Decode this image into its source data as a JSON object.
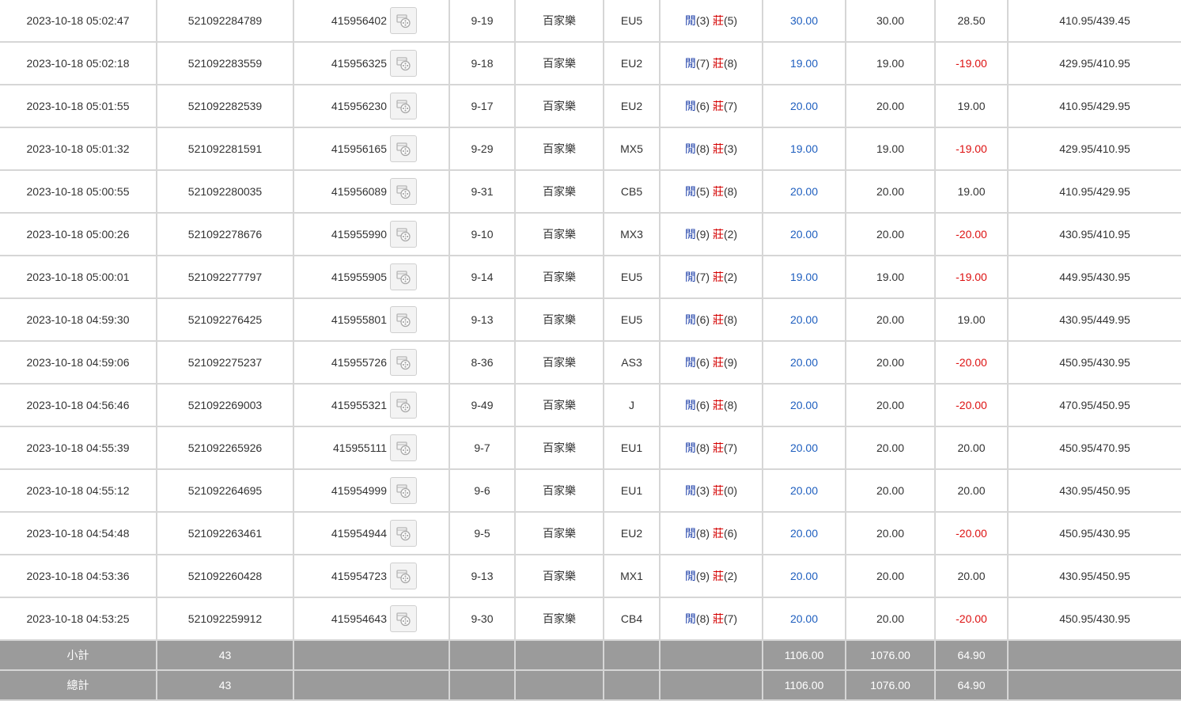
{
  "rows": [
    {
      "time": "2023-10-18 05:02:47",
      "bet_id": "521092284789",
      "round_id": "415956402",
      "shoe": "9-19",
      "game": "百家樂",
      "table": "EU5",
      "player_label": "閒",
      "player_score": "(3)",
      "banker_label": "莊",
      "banker_score": "(5)",
      "bet": "30.00",
      "valid": "30.00",
      "winloss": "28.50",
      "winloss_negative": false,
      "balance": "410.95/439.45"
    },
    {
      "time": "2023-10-18 05:02:18",
      "bet_id": "521092283559",
      "round_id": "415956325",
      "shoe": "9-18",
      "game": "百家樂",
      "table": "EU2",
      "player_label": "閒",
      "player_score": "(7)",
      "banker_label": "莊",
      "banker_score": "(8)",
      "bet": "19.00",
      "valid": "19.00",
      "winloss": "-19.00",
      "winloss_negative": true,
      "balance": "429.95/410.95"
    },
    {
      "time": "2023-10-18 05:01:55",
      "bet_id": "521092282539",
      "round_id": "415956230",
      "shoe": "9-17",
      "game": "百家樂",
      "table": "EU2",
      "player_label": "閒",
      "player_score": "(6)",
      "banker_label": "莊",
      "banker_score": "(7)",
      "bet": "20.00",
      "valid": "20.00",
      "winloss": "19.00",
      "winloss_negative": false,
      "balance": "410.95/429.95"
    },
    {
      "time": "2023-10-18 05:01:32",
      "bet_id": "521092281591",
      "round_id": "415956165",
      "shoe": "9-29",
      "game": "百家樂",
      "table": "MX5",
      "player_label": "閒",
      "player_score": "(8)",
      "banker_label": "莊",
      "banker_score": "(3)",
      "bet": "19.00",
      "valid": "19.00",
      "winloss": "-19.00",
      "winloss_negative": true,
      "balance": "429.95/410.95"
    },
    {
      "time": "2023-10-18 05:00:55",
      "bet_id": "521092280035",
      "round_id": "415956089",
      "shoe": "9-31",
      "game": "百家樂",
      "table": "CB5",
      "player_label": "閒",
      "player_score": "(5)",
      "banker_label": "莊",
      "banker_score": "(8)",
      "bet": "20.00",
      "valid": "20.00",
      "winloss": "19.00",
      "winloss_negative": false,
      "balance": "410.95/429.95"
    },
    {
      "time": "2023-10-18 05:00:26",
      "bet_id": "521092278676",
      "round_id": "415955990",
      "shoe": "9-10",
      "game": "百家樂",
      "table": "MX3",
      "player_label": "閒",
      "player_score": "(9)",
      "banker_label": "莊",
      "banker_score": "(2)",
      "bet": "20.00",
      "valid": "20.00",
      "winloss": "-20.00",
      "winloss_negative": true,
      "balance": "430.95/410.95"
    },
    {
      "time": "2023-10-18 05:00:01",
      "bet_id": "521092277797",
      "round_id": "415955905",
      "shoe": "9-14",
      "game": "百家樂",
      "table": "EU5",
      "player_label": "閒",
      "player_score": "(7)",
      "banker_label": "莊",
      "banker_score": "(2)",
      "bet": "19.00",
      "valid": "19.00",
      "winloss": "-19.00",
      "winloss_negative": true,
      "balance": "449.95/430.95"
    },
    {
      "time": "2023-10-18 04:59:30",
      "bet_id": "521092276425",
      "round_id": "415955801",
      "shoe": "9-13",
      "game": "百家樂",
      "table": "EU5",
      "player_label": "閒",
      "player_score": "(6)",
      "banker_label": "莊",
      "banker_score": "(8)",
      "bet": "20.00",
      "valid": "20.00",
      "winloss": "19.00",
      "winloss_negative": false,
      "balance": "430.95/449.95"
    },
    {
      "time": "2023-10-18 04:59:06",
      "bet_id": "521092275237",
      "round_id": "415955726",
      "shoe": "8-36",
      "game": "百家樂",
      "table": "AS3",
      "player_label": "閒",
      "player_score": "(6)",
      "banker_label": "莊",
      "banker_score": "(9)",
      "bet": "20.00",
      "valid": "20.00",
      "winloss": "-20.00",
      "winloss_negative": true,
      "balance": "450.95/430.95"
    },
    {
      "time": "2023-10-18 04:56:46",
      "bet_id": "521092269003",
      "round_id": "415955321",
      "shoe": "9-49",
      "game": "百家樂",
      "table": "J",
      "player_label": "閒",
      "player_score": "(6)",
      "banker_label": "莊",
      "banker_score": "(8)",
      "bet": "20.00",
      "valid": "20.00",
      "winloss": "-20.00",
      "winloss_negative": true,
      "balance": "470.95/450.95"
    },
    {
      "time": "2023-10-18 04:55:39",
      "bet_id": "521092265926",
      "round_id": "415955111",
      "shoe": "9-7",
      "game": "百家樂",
      "table": "EU1",
      "player_label": "閒",
      "player_score": "(8)",
      "banker_label": "莊",
      "banker_score": "(7)",
      "bet": "20.00",
      "valid": "20.00",
      "winloss": "20.00",
      "winloss_negative": false,
      "balance": "450.95/470.95"
    },
    {
      "time": "2023-10-18 04:55:12",
      "bet_id": "521092264695",
      "round_id": "415954999",
      "shoe": "9-6",
      "game": "百家樂",
      "table": "EU1",
      "player_label": "閒",
      "player_score": "(3)",
      "banker_label": "莊",
      "banker_score": "(0)",
      "bet": "20.00",
      "valid": "20.00",
      "winloss": "20.00",
      "winloss_negative": false,
      "balance": "430.95/450.95"
    },
    {
      "time": "2023-10-18 04:54:48",
      "bet_id": "521092263461",
      "round_id": "415954944",
      "shoe": "9-5",
      "game": "百家樂",
      "table": "EU2",
      "player_label": "閒",
      "player_score": "(8)",
      "banker_label": "莊",
      "banker_score": "(6)",
      "bet": "20.00",
      "valid": "20.00",
      "winloss": "-20.00",
      "winloss_negative": true,
      "balance": "450.95/430.95"
    },
    {
      "time": "2023-10-18 04:53:36",
      "bet_id": "521092260428",
      "round_id": "415954723",
      "shoe": "9-13",
      "game": "百家樂",
      "table": "MX1",
      "player_label": "閒",
      "player_score": "(9)",
      "banker_label": "莊",
      "banker_score": "(2)",
      "bet": "20.00",
      "valid": "20.00",
      "winloss": "20.00",
      "winloss_negative": false,
      "balance": "430.95/450.95"
    },
    {
      "time": "2023-10-18 04:53:25",
      "bet_id": "521092259912",
      "round_id": "415954643",
      "shoe": "9-30",
      "game": "百家樂",
      "table": "CB4",
      "player_label": "閒",
      "player_score": "(8)",
      "banker_label": "莊",
      "banker_score": "(7)",
      "bet": "20.00",
      "valid": "20.00",
      "winloss": "-20.00",
      "winloss_negative": true,
      "balance": "450.95/430.95"
    }
  ],
  "subtotal": {
    "label": "小計",
    "count": "43",
    "bet": "1106.00",
    "valid": "1076.00",
    "winloss": "64.90"
  },
  "total": {
    "label": "總計",
    "count": "43",
    "bet": "1106.00",
    "valid": "1076.00",
    "winloss": "64.90"
  },
  "icons": {
    "replay": "film-reel-icon"
  },
  "colors": {
    "positive_amount": "#1f5fbf",
    "negative_amount": "#dd1111",
    "player": "#1d3fa8",
    "banker": "#d40000",
    "summary_bg": "#9b9b9b"
  }
}
